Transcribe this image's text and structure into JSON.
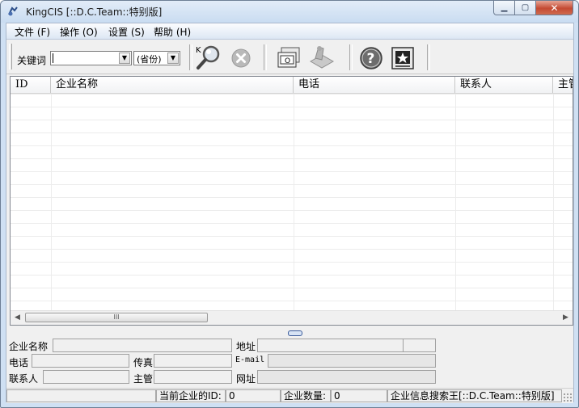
{
  "window": {
    "title": "KingCIS [::D.C.Team::特别版]"
  },
  "menu": [
    "文件 (F)",
    "操作 (O)",
    "设置 (S)",
    "帮助 (H)"
  ],
  "toolbar": {
    "keyword_label": "关键词",
    "keyword_value": "",
    "province_value": "(省份)",
    "icons": [
      "search-icon",
      "clear-icon",
      "card-icon",
      "scanner-icon",
      "help-icon",
      "favorite-icon"
    ]
  },
  "grid": {
    "columns": [
      "ID",
      "企业名称",
      "电话",
      "联系人",
      "主管"
    ],
    "scroll_thumb_glyph": "III"
  },
  "details": {
    "company_name_label": "企业名称",
    "address_label": "地址",
    "phone_label": "电话",
    "fax_label": "传真",
    "email_label": "E-mail",
    "contact_label": "联系人",
    "manager_label": "主管",
    "website_label": "网址"
  },
  "status": {
    "current_id_label": "当前企业的ID:",
    "current_id_value": "0",
    "count_label": "企业数量:",
    "count_value": "0",
    "app_name": "企业信息搜索王[::D.C.Team::特别版]"
  }
}
